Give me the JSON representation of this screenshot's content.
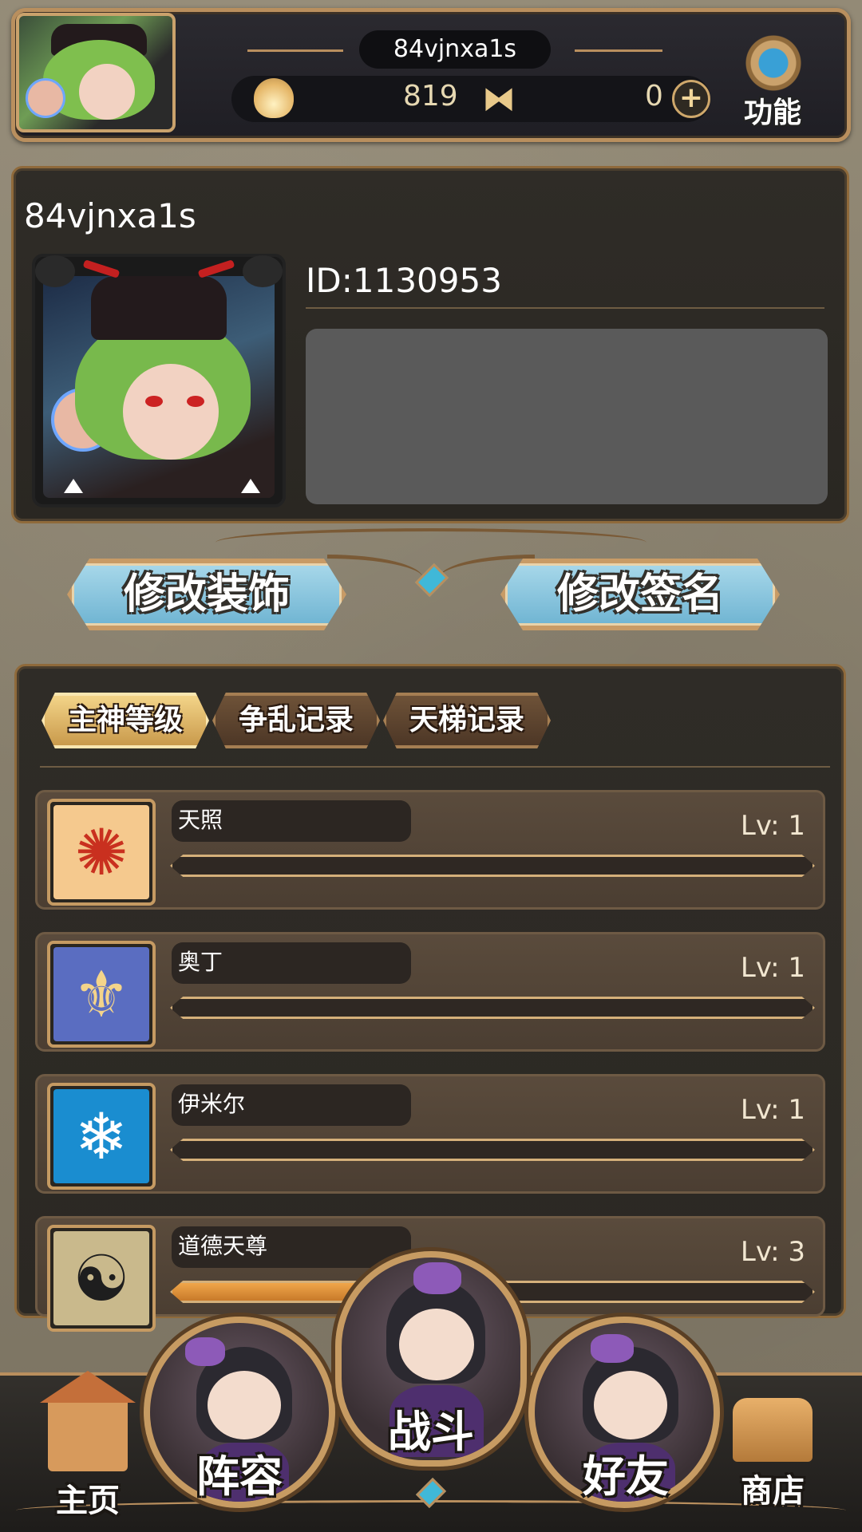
{
  "header": {
    "username": "84vjnxa1s",
    "flame_count": "819",
    "butterfly_count": "0",
    "function_label": "功能"
  },
  "profile": {
    "name": "84vjnxa1s",
    "id_text": "ID:1130953",
    "signature": ""
  },
  "actions": {
    "edit_decoration": "修改装饰",
    "edit_signature": "修改签名"
  },
  "tabs": [
    {
      "label": "主神等级",
      "active": true
    },
    {
      "label": "争乱记录",
      "active": false
    },
    {
      "label": "天梯记录",
      "active": false
    }
  ],
  "gods": [
    {
      "name": "天照",
      "level_text": "Lv: 1",
      "progress": 0,
      "icon": "sun-icon"
    },
    {
      "name": "奥丁",
      "level_text": "Lv: 1",
      "progress": 0,
      "icon": "wings-icon"
    },
    {
      "name": "伊米尔",
      "level_text": "Lv: 1",
      "progress": 0,
      "icon": "ice-horns-icon"
    },
    {
      "name": "道德天尊",
      "level_text": "Lv: 3",
      "progress": 0.44,
      "icon": "taiji-icon"
    }
  ],
  "nav": {
    "home": "主页",
    "lineup": "阵容",
    "battle": "战斗",
    "friends": "好友",
    "shop": "商店"
  },
  "colors": {
    "accent_gold": "#b98f5e",
    "button_blue": "#8ec7df",
    "panel_dark": "#2e2b26",
    "progress_orange": "#e08a35"
  }
}
